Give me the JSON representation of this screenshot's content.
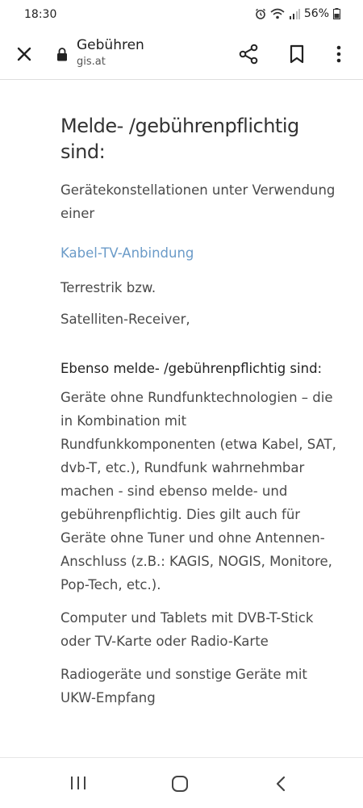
{
  "status": {
    "time": "18:30",
    "battery": "56%"
  },
  "toolbar": {
    "title": "Gebühren",
    "domain": "gis.at"
  },
  "content": {
    "heading": "Melde- /gebührenpflichtig sind:",
    "intro": "Gerätekonstellationen unter Verwendung einer",
    "link": "Kabel-TV-Anbindung",
    "line1": "Terrestrik bzw.",
    "line2": "Satelliten-Receiver,",
    "subheading": "Ebenso melde- /gebührenpflichtig sind:",
    "paragraph1": "Geräte ohne Rundfunktechnologien – die in Kombination mit Rundfunkkomponenten (etwa Kabel, SAT, dvb-T, etc.), Rundfunk wahrnehmbar machen - sind ebenso melde- und gebührenpflichtig. Dies gilt auch für Geräte ohne Tuner und ohne Antennen-Anschluss (z.B.: KAGIS, NOGIS, Monitore, Pop-Tech, etc.).",
    "paragraph2": "Computer und Tablets mit DVB-T-Stick oder TV-Karte oder Radio-Karte",
    "paragraph3": "Radiogeräte und sonstige Geräte mit UKW-Empfang"
  },
  "icons": {
    "close": "close-icon",
    "lock": "lock-icon",
    "share": "share-icon",
    "bookmark": "bookmark-icon",
    "menu": "more-vert-icon",
    "recent": "recent-apps-icon",
    "home": "home-icon",
    "back": "back-icon"
  },
  "colors": {
    "link": "#6b9bc8",
    "text": "#4a4a4a"
  }
}
